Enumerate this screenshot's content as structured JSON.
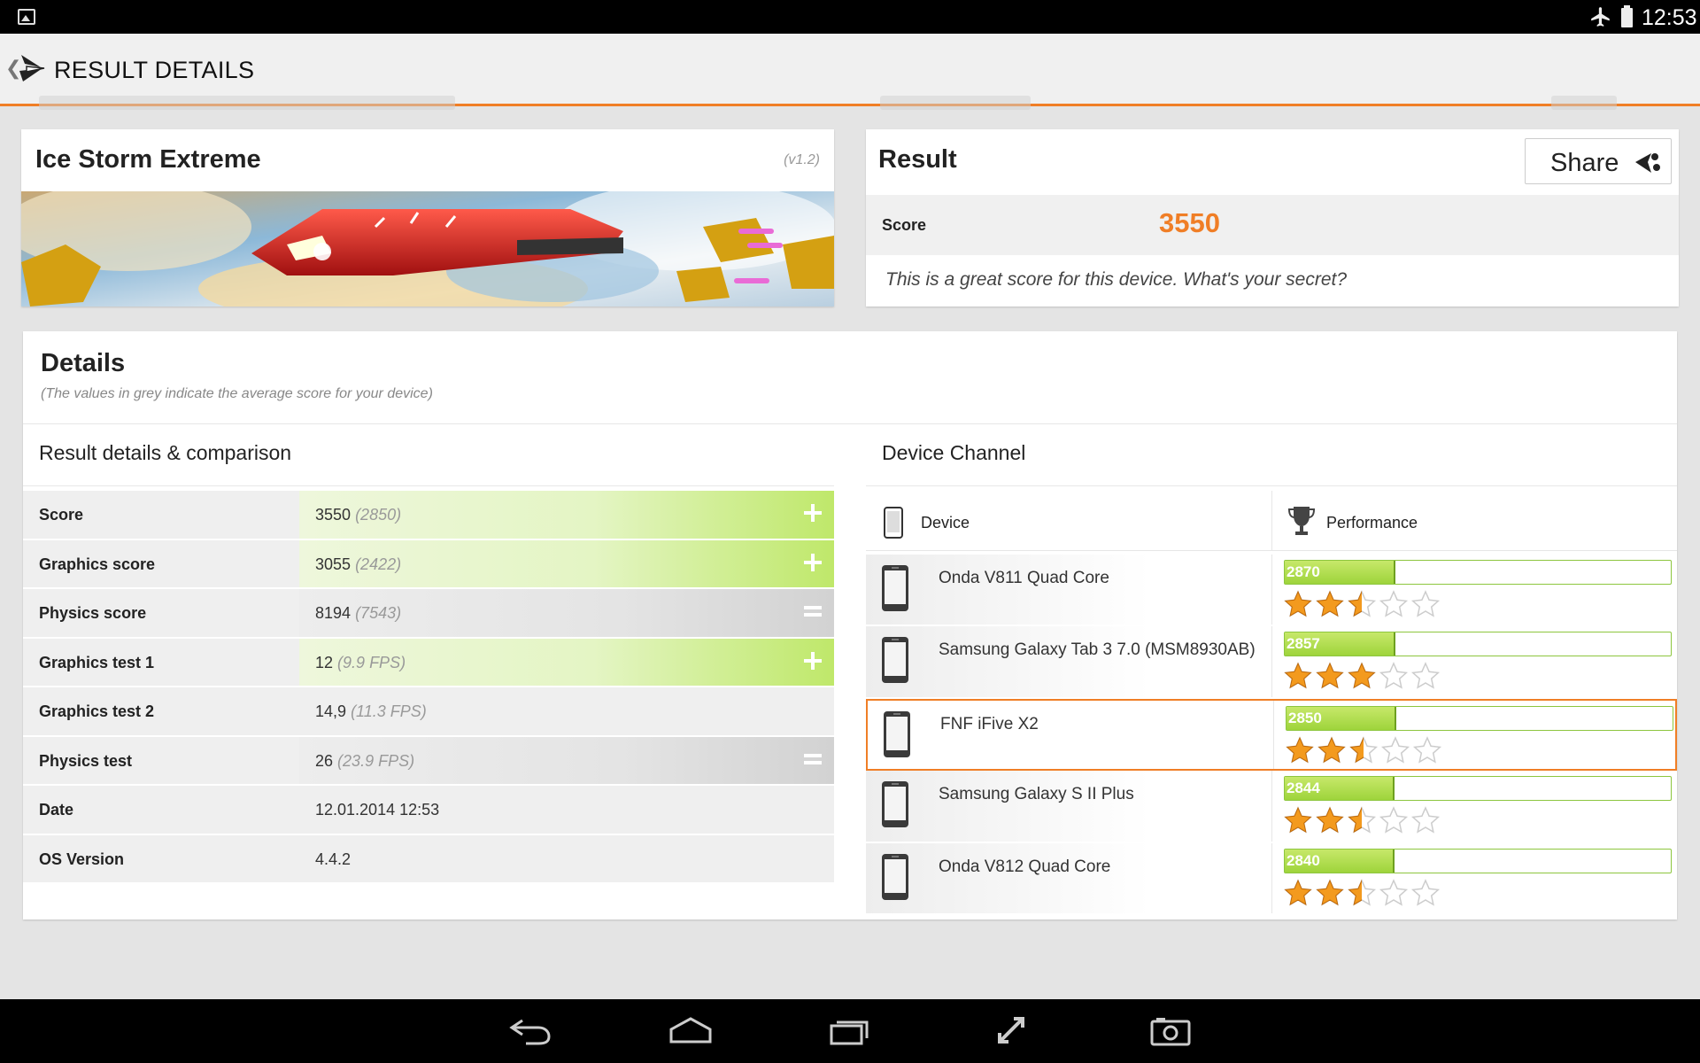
{
  "status_bar": {
    "time": "12:53"
  },
  "action_bar": {
    "title": "RESULT DETAILS"
  },
  "test": {
    "name": "Ice Storm Extreme",
    "version": "(v1.2)"
  },
  "result": {
    "heading": "Result",
    "share_label": "Share",
    "score_label": "Score",
    "score_value": "3550",
    "comment": "This is a great score for this device. What's your secret?"
  },
  "details": {
    "heading": "Details",
    "subtitle": "(The values in grey indicate the average score for your device)",
    "comparison_title": "Result details & comparison",
    "rows": [
      {
        "label": "Score",
        "value": "3550",
        "average": "(2850)",
        "indicator": "plus"
      },
      {
        "label": "Graphics score",
        "value": "3055",
        "average": "(2422)",
        "indicator": "plus"
      },
      {
        "label": "Physics score",
        "value": "8194",
        "average": "(7543)",
        "indicator": "equal"
      },
      {
        "label": "Graphics test 1",
        "value": "12",
        "average": "(9.9 FPS)",
        "indicator": "plus"
      },
      {
        "label": "Graphics test 2",
        "value": "14,9",
        "average": "(11.3 FPS)",
        "indicator": "none"
      },
      {
        "label": "Physics test",
        "value": "26",
        "average": "(23.9 FPS)",
        "indicator": "equal"
      },
      {
        "label": "Date",
        "value": "12.01.2014 12:53",
        "average": "",
        "indicator": "none"
      },
      {
        "label": "OS Version",
        "value": "4.4.2",
        "average": "",
        "indicator": "none"
      }
    ]
  },
  "device_channel": {
    "title": "Device Channel",
    "col_device": "Device",
    "col_performance": "Performance",
    "bar_max": 10000,
    "devices": [
      {
        "name": "Onda V811 Quad Core",
        "score": "2870",
        "score_num": 2870,
        "stars": 2.5,
        "current": false
      },
      {
        "name": "Samsung Galaxy Tab 3 7.0 (MSM8930AB)",
        "score": "2857",
        "score_num": 2857,
        "stars": 3,
        "current": false
      },
      {
        "name": "FNF iFive X2",
        "score": "2850",
        "score_num": 2850,
        "stars": 2.5,
        "current": true
      },
      {
        "name": "Samsung Galaxy S II Plus",
        "score": "2844",
        "score_num": 2844,
        "stars": 2.5,
        "current": false
      },
      {
        "name": "Onda V812 Quad Core",
        "score": "2840",
        "score_num": 2840,
        "stars": 2.5,
        "current": false
      }
    ]
  },
  "colors": {
    "accent": "#f07e26",
    "bar_green": "#9ed43b",
    "star_orange": "#f39a1e"
  },
  "icons": {
    "status": [
      "gallery-icon",
      "airplane-mode-icon",
      "battery-icon"
    ],
    "navigation": [
      "back-icon",
      "home-icon",
      "recent-apps-icon",
      "fullscreen-icon",
      "screenshot-icon"
    ]
  }
}
